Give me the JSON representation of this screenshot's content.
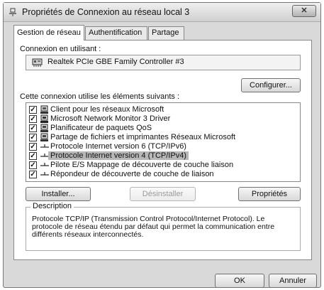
{
  "window": {
    "title": "Propriétés de Connexion au réseau local 3",
    "close_label": "✕"
  },
  "tabs": [
    {
      "label": "Gestion de réseau",
      "active": true
    },
    {
      "label": "Authentification",
      "active": false
    },
    {
      "label": "Partage",
      "active": false
    }
  ],
  "connect_using": {
    "label": "Connexion en utilisant :",
    "adapter": "Realtek PCIe GBE Family Controller #3",
    "configure_button": "Configurer..."
  },
  "components": {
    "label": "Cette connexion utilise les éléments suivants :",
    "items": [
      {
        "label": "Client pour les réseaux Microsoft",
        "checked": true,
        "icon": "network-client-icon"
      },
      {
        "label": "Microsoft Network Monitor 3 Driver",
        "checked": true,
        "icon": "driver-icon"
      },
      {
        "label": "Planificateur de paquets QoS",
        "checked": true,
        "icon": "service-icon"
      },
      {
        "label": "Partage de fichiers et imprimantes Réseaux Microsoft",
        "checked": true,
        "icon": "file-printer-sharing-icon"
      },
      {
        "label": "Protocole Internet version 6 (TCP/IPv6)",
        "checked": true,
        "icon": "protocol-icon"
      },
      {
        "label": "Protocole Internet version 4 (TCP/IPv4)",
        "checked": true,
        "icon": "protocol-icon",
        "selected": true
      },
      {
        "label": "Pilote E/S Mappage de découverte de couche liaison",
        "checked": true,
        "icon": "protocol-icon"
      },
      {
        "label": "Répondeur de découverte de couche de liaison",
        "checked": true,
        "icon": "protocol-icon"
      }
    ],
    "check_mark": "✓"
  },
  "actions": {
    "install": "Installer...",
    "uninstall": "Désinstaller",
    "properties": "Propriétés"
  },
  "description": {
    "legend": "Description",
    "text": "Protocole TCP/IP (Transmission Control Protocol/Internet Protocol). Le protocole de réseau étendu par défaut qui permet la communication entre différents réseaux interconnectés."
  },
  "footer": {
    "ok": "OK",
    "cancel": "Annuler"
  }
}
